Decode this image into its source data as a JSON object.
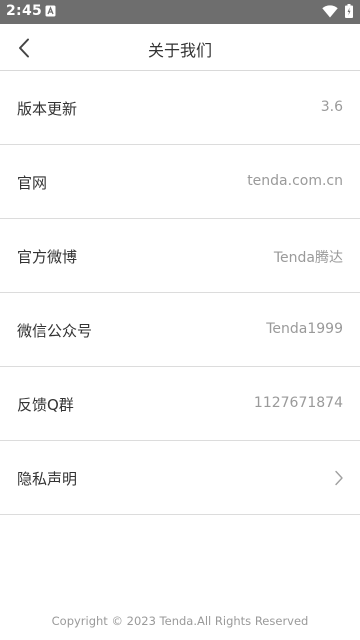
{
  "status_bar": {
    "time": "2:45",
    "icons": [
      "app-notification-icon",
      "wifi-icon",
      "battery-icon"
    ]
  },
  "header": {
    "title": "关于我们",
    "back_icon": "chevron-left-icon"
  },
  "rows": [
    {
      "label": "版本更新",
      "value": "3.6"
    },
    {
      "label": "官网",
      "value": "tenda.com.cn"
    },
    {
      "label": "官方微博",
      "value": "Tenda腾达"
    },
    {
      "label": "微信公众号",
      "value": "Tenda1999"
    },
    {
      "label": "反馈Q群",
      "value": "1127671874"
    },
    {
      "label": "隐私声明",
      "icon": "chevron-right-icon"
    }
  ],
  "footer": {
    "copyright": "Copyright © 2023 Tenda.All Rights Reserved"
  },
  "colors": {
    "status_bar_bg": "#6e6e6e",
    "text_primary": "#333333",
    "text_secondary": "#9a9a9a",
    "divider": "#dcdcdc"
  }
}
